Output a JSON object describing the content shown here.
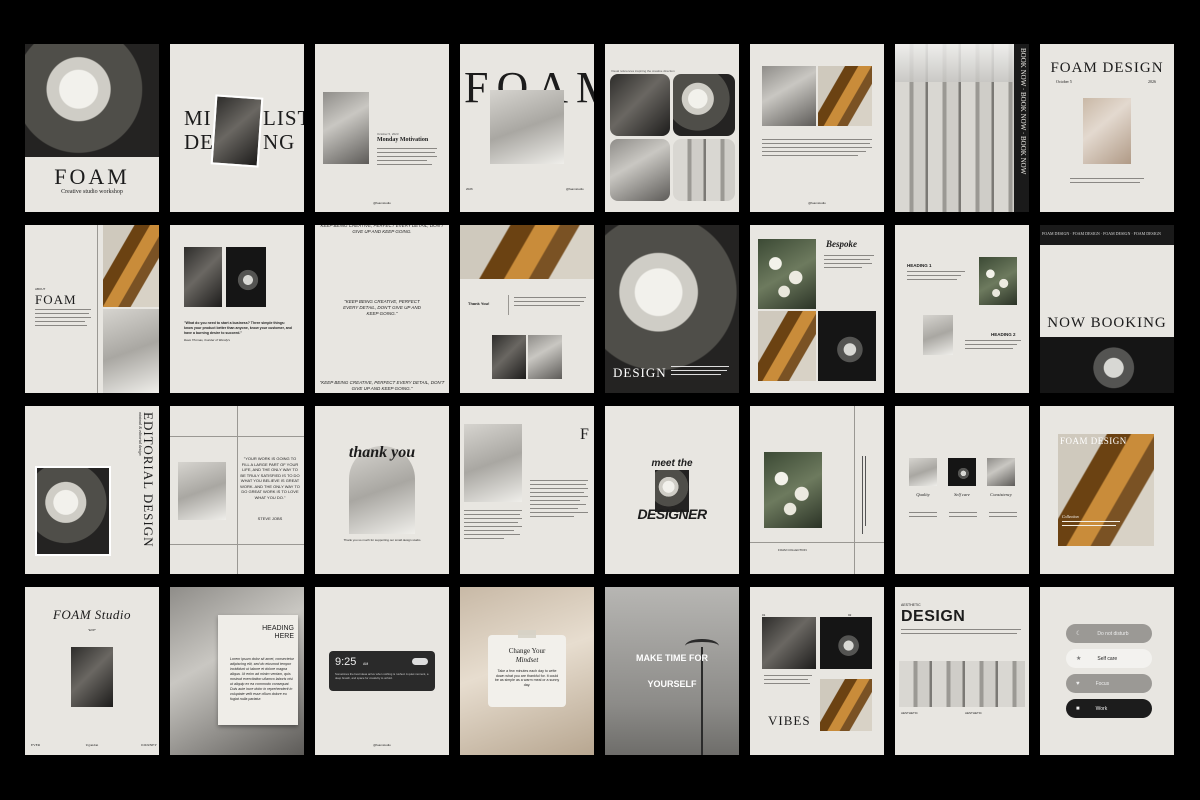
{
  "colors": {
    "page_bg": "#000000",
    "card_bg": "#e8e6e1",
    "ink": "#1c1c1c",
    "amber": "#c98c3a"
  },
  "row1": {
    "c1": {
      "title": "FOAM",
      "subtitle": "Creative studio workshop"
    },
    "c2": {
      "line1a": "MI",
      "line1b": "LIST",
      "line2a": "DE",
      "line2b": "NG"
    },
    "c3": {
      "date": "October 5, 2023",
      "title": "Monday Motivation",
      "handle": "@foamstudio"
    },
    "c4": {
      "title": "FOAM",
      "left_caption": "2026",
      "right_caption": "@foamstudio"
    },
    "c5": {
      "caption": "Visual references inspiring the creative direction"
    },
    "c6": {
      "handle": "@foamstudio"
    },
    "c7": {
      "side_text": "BOOK NOW · BOOK NOW · BOOK NOW"
    },
    "c8": {
      "title": "FOAM DESIGN",
      "date": "October 5",
      "year": "2026"
    }
  },
  "row2": {
    "c1": {
      "kicker": "ABOUT",
      "title": "FOAM"
    },
    "c2": {
      "quote": "\"What do you need to start a business? Three simple things: know your product better than anyone, know your customer, and have a burning desire to succeed.\"",
      "author": "Dave Thomas, founder of Wendy's"
    },
    "c3": {
      "top": "KEEP BEING CREATIVE, PERFECT EVERY DETAIL, DON'T GIVE UP AND KEEP GOING.",
      "middle": "\"KEEP BEING CREATIVE, PERFECT EVERY DETAIL, DON'T GIVE UP AND KEEP GOING.\"",
      "bottom": "\"KEEP BEING CREATIVE, PERFECT EVERY DETAIL, DON'T GIVE UP AND KEEP GOING.\""
    },
    "c4": {
      "label": "Thank You!"
    },
    "c5": {
      "title": "DESIGN"
    },
    "c6": {
      "title": "Bespoke"
    },
    "c7": {
      "heading1": "HEADING 1",
      "heading2": "HEADING 2"
    },
    "c8": {
      "ticker": "FOAM DESIGN · FOAM DESIGN · FOAM DESIGN · FOAM DESIGN",
      "title": "NOW BOOKING"
    }
  },
  "row3": {
    "c1": {
      "kicker": "minimal & editorial design",
      "title": "EDITORIAL DESIGN"
    },
    "c2": {
      "quote": "\"YOUR WORK IS GOING TO FILL A LARGE PART OF YOUR LIFE, AND THE ONLY WAY TO BE TRULY SATISFIED IS TO DO WHAT YOU BELIEVE IS GREAT WORK. AND THE ONLY WAY TO DO GREAT WORK IS TO LOVE WHAT YOU DO.\"",
      "author": "STEVE JOBS"
    },
    "c3": {
      "title": "thank you",
      "caption": "Thank you so much for supporting our small design studio"
    },
    "c4": {
      "letter": "F"
    },
    "c5": {
      "top": "meet the",
      "bottom": "DESIGNER"
    },
    "c6": {
      "caption": "FOAM COLLECTION"
    },
    "c7": {
      "label1": "Quality",
      "label2": "Self care",
      "label3": "Consistency"
    },
    "c8": {
      "title": "FOAM DESIGN",
      "label": "Collection"
    }
  },
  "row4": {
    "c1": {
      "title": "FOAM Studio",
      "sub": "\"EXP\"",
      "left": "EVER",
      "mid": "Ugandan",
      "right": "JOURNEY"
    },
    "c2": {
      "heading": "HEADING HERE",
      "body": "Lorem ipsum dolor sit amet, consectetur adipiscing elit, sed do eiusmod tempor incididunt ut labore et dolore magna aliqua. Ut enim ad minim veniam, quis nostrud exercitation ullamco laboris nisi ut aliquip ex ea commodo consequat. Duis aute irure dolor in reprehenderit in voluptate velit esse cillum dolore eu fugiat nulla pariatur."
    },
    "c3": {
      "time": "9:25",
      "ampm": "AM",
      "body": "Sometimes the best ideas arrive when nothing is rushed. A quiet moment, a deep breath, and space for creativity to unfold.",
      "handle": "@foamstudio"
    },
    "c4": {
      "title": "Change Your",
      "title2": "Mindset",
      "body": "Take a few minutes each day to write down what you are thankful for. It could be as simple as a warm meal or a sunny day."
    },
    "c5": {
      "line1": "MAKE TIME FOR",
      "line2": "YOURSELF"
    },
    "c6": {
      "title": "VIBES",
      "num1": "01",
      "num2": "02"
    },
    "c7": {
      "kicker": "AESTHETIC",
      "title": "DESIGN",
      "left": "AESTHETIC",
      "right": "AESTHETIC"
    },
    "c8": {
      "item1": "Do not disturb",
      "item2": "Self care",
      "item3": "Focus",
      "item4": "Work"
    }
  }
}
